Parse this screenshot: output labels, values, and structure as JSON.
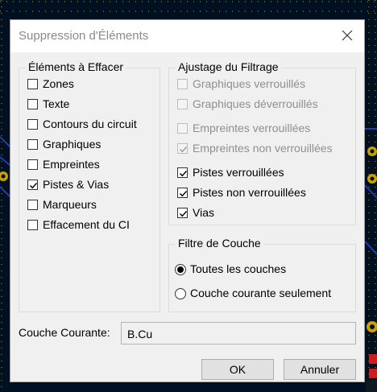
{
  "window": {
    "title": "Suppression d'Éléments"
  },
  "elements_group": {
    "title": "Éléments à Effacer",
    "items": [
      {
        "label": "Zones",
        "checked": false
      },
      {
        "label": "Texte",
        "checked": false
      },
      {
        "label": "Contours du circuit",
        "checked": false
      },
      {
        "label": "Graphiques",
        "checked": false
      },
      {
        "label": "Empreintes",
        "checked": false
      },
      {
        "label": "Pistes & Vias",
        "checked": true
      },
      {
        "label": "Marqueurs",
        "checked": false
      },
      {
        "label": "Effacement du CI",
        "checked": false
      }
    ]
  },
  "filter_group": {
    "title": "Ajustage du Filtrage",
    "items": [
      {
        "label": "Graphiques verrouillés",
        "checked": false,
        "enabled": false
      },
      {
        "label": "Graphiques déverrouillés",
        "checked": false,
        "enabled": false
      },
      {
        "label": "Empreintes verrouillées",
        "checked": false,
        "enabled": false
      },
      {
        "label": "Empreintes non verrouillées",
        "checked": true,
        "enabled": false
      },
      {
        "label": "Pistes verrouillées",
        "checked": true,
        "enabled": true
      },
      {
        "label": "Pistes non verrouillées",
        "checked": true,
        "enabled": true
      },
      {
        "label": "Vias",
        "checked": true,
        "enabled": true
      }
    ]
  },
  "layer_group": {
    "title": "Filtre de Couche",
    "options": [
      {
        "label": "Toutes les couches",
        "selected": true
      },
      {
        "label": "Couche courante seulement",
        "selected": false
      }
    ]
  },
  "current_layer": {
    "label": "Couche Courante:",
    "value": "B.Cu"
  },
  "buttons": {
    "ok": "OK",
    "cancel": "Annuler"
  },
  "colors": {
    "pcb_background": "#001023",
    "pad_yellow": "#c8a000",
    "track_blue": "#1e3cb4",
    "pad_red": "#c81e1e"
  }
}
